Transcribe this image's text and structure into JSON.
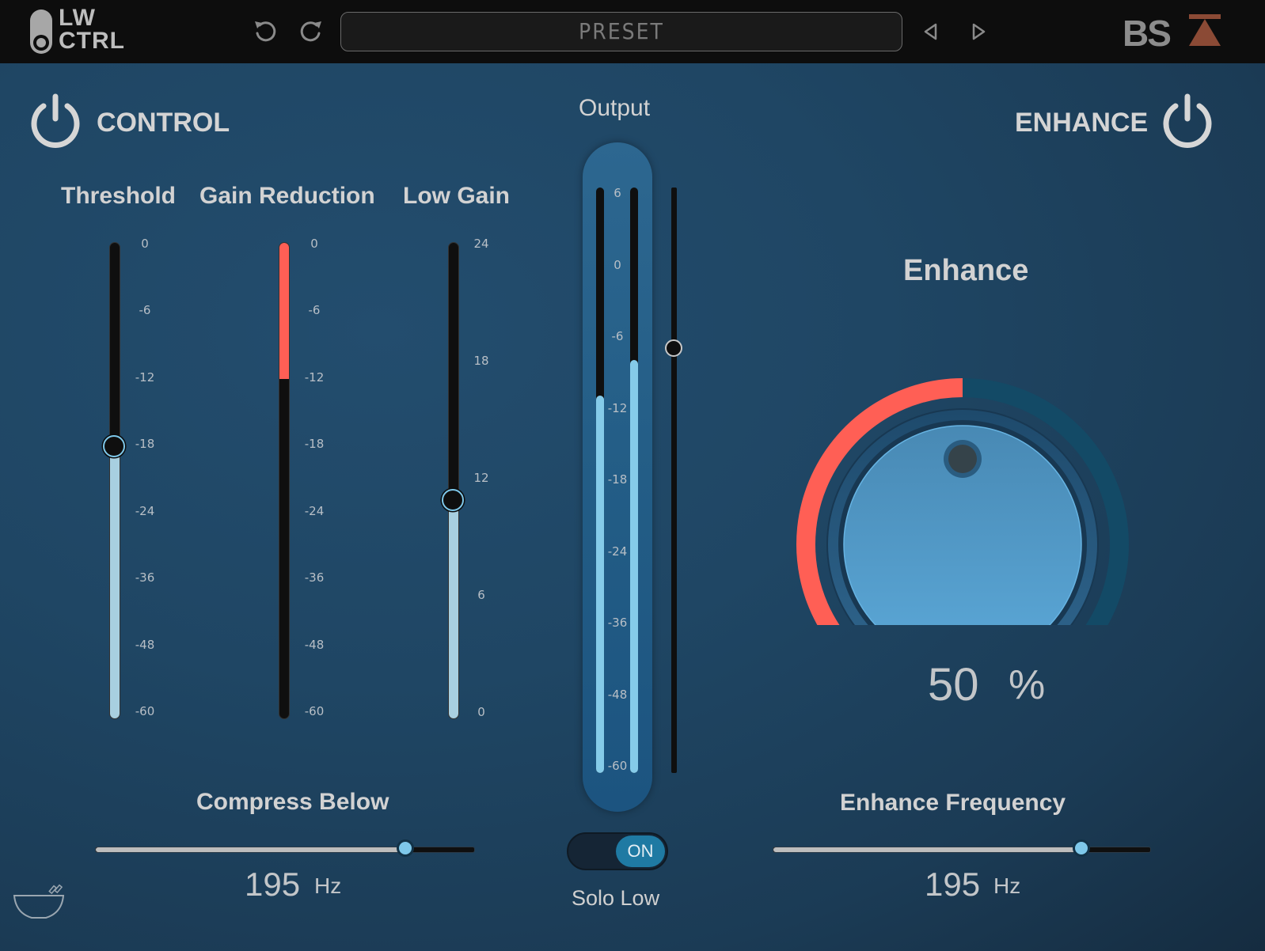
{
  "app": {
    "logo_line1": "LW",
    "logo_line2": "CTRL",
    "brand": "BSA",
    "colors": {
      "accent_blue": "#7ec8ea",
      "meter_blue": "#85cbe9",
      "gain_reduction_red": "#ff5f55",
      "brand_orange": "#8b4a35",
      "background": "#1f4664"
    }
  },
  "toolbar": {
    "undo_icon": "undo-icon",
    "redo_icon": "redo-icon",
    "preset_label": "PRESET",
    "prev_icon": "triangle-left-icon",
    "next_icon": "triangle-right-icon"
  },
  "control": {
    "title": "CONTROL",
    "power_icon": "power-icon",
    "enabled": true,
    "threshold": {
      "label": "Threshold",
      "value_db": -18,
      "scale": [
        "0",
        "-6",
        "-12",
        "-18",
        "-24",
        "-36",
        "-48",
        "-60"
      ]
    },
    "gain_reduction": {
      "label": "Gain Reduction",
      "value_db": -12,
      "scale": [
        "0",
        "-6",
        "-12",
        "-18",
        "-24",
        "-36",
        "-48",
        "-60"
      ]
    },
    "low_gain": {
      "label": "Low Gain",
      "value_db": 11,
      "scale": [
        "24",
        "18",
        "12",
        "6",
        "0"
      ]
    },
    "compress_below": {
      "label": "Compress Below",
      "value": "195",
      "unit": "Hz",
      "position_fraction": 0.82
    }
  },
  "output": {
    "label": "Output",
    "scale": [
      "6",
      "0",
      "-6",
      "-12",
      "-18",
      "-24",
      "-36",
      "-48",
      "-60"
    ],
    "meter_left_db": -11,
    "meter_right_db": -8,
    "fader_db": -7,
    "solo_low": {
      "label": "Solo Low",
      "state": "ON"
    }
  },
  "enhance": {
    "title": "ENHANCE",
    "power_icon": "power-icon",
    "enabled": true,
    "knob_label": "Enhance",
    "value": "50",
    "unit": "%",
    "value_fraction": 0.5,
    "frequency": {
      "label": "Enhance Frequency",
      "value": "195",
      "unit": "Hz",
      "position_fraction": 0.82
    }
  },
  "footer": {
    "bowl_icon": "bowl-icon"
  }
}
